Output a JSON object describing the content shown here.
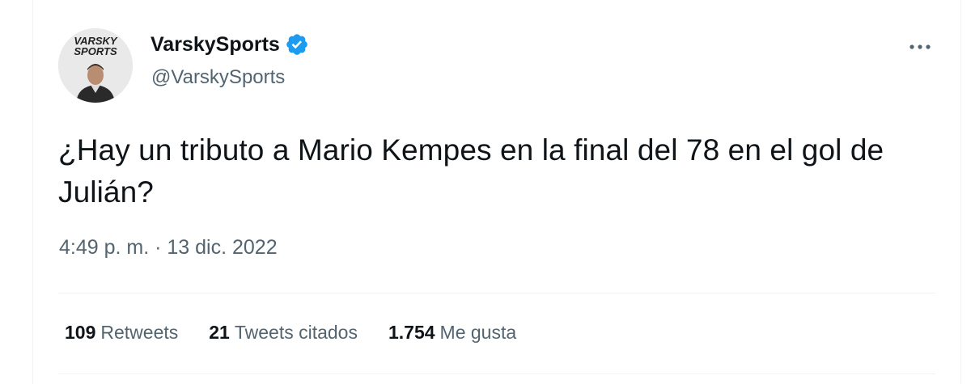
{
  "author": {
    "display_name": "VarskySports",
    "handle": "@VarskySports",
    "verified": true,
    "avatar_text_line1": "VARSKY",
    "avatar_text_line2": "SPORTS"
  },
  "tweet": {
    "text": "¿Hay un tributo a Mario Kempes en la final del 78 en el gol de Julián?",
    "timestamp": "4:49 p. m. · 13 dic. 2022"
  },
  "stats": [
    {
      "count": "109",
      "label": "Retweets"
    },
    {
      "count": "21",
      "label": "Tweets citados"
    },
    {
      "count": "1.754",
      "label": "Me gusta"
    }
  ],
  "icons": {
    "verified": "verified-badge-icon",
    "more": "more-options-icon"
  },
  "colors": {
    "text_primary": "#0f1419",
    "text_secondary": "#536471",
    "verified_blue": "#1d9bf0",
    "divider": "#eff3f4"
  }
}
